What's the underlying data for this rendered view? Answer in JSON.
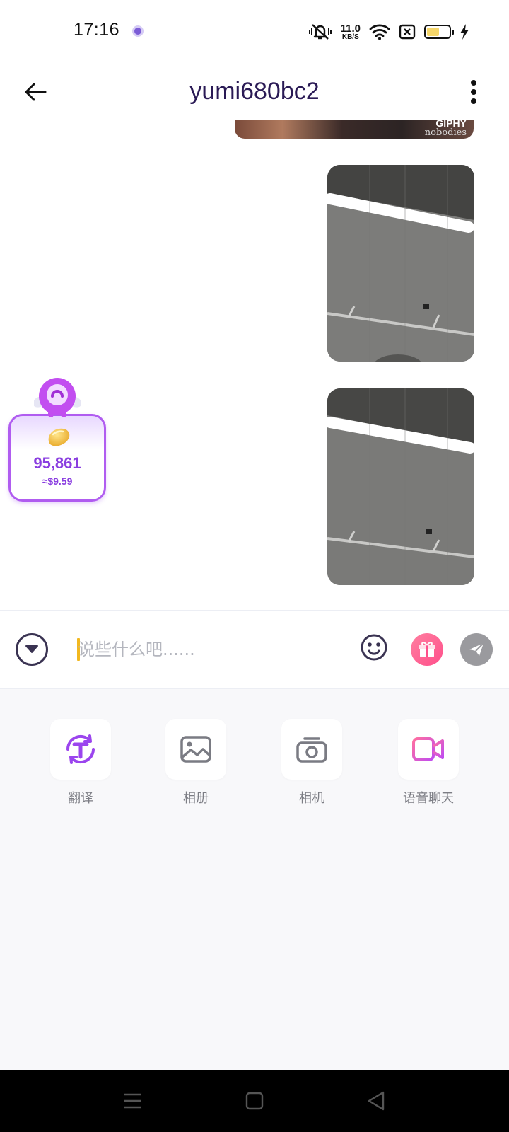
{
  "status_bar": {
    "time": "17:16",
    "net_speed_value": "11.0",
    "net_speed_unit": "KB/S",
    "battery_level": 0.6,
    "battery_color": "#f5d66a",
    "icons": [
      "app-notification-icon",
      "vibrate-icon",
      "wifi-icon",
      "no-sim-icon",
      "battery-icon",
      "charging-icon"
    ]
  },
  "header": {
    "title": "yumi680bc2",
    "back_icon": "back-arrow-icon",
    "more_icon": "more-vertical-icon"
  },
  "chat": {
    "gif_badge": "GIPHY",
    "gif_caption": "nobodies",
    "messages": [
      {
        "type": "gif",
        "side": "right"
      },
      {
        "type": "image",
        "side": "right"
      },
      {
        "type": "image",
        "side": "right"
      }
    ]
  },
  "reward": {
    "amount": "95,861",
    "usd": "≈$9.59",
    "icon": "bean-icon",
    "accent": "#a855f7"
  },
  "input": {
    "placeholder": "说些什么吧......",
    "value": "",
    "icons": [
      "collapse-icon",
      "emoji-icon",
      "gift-icon",
      "send-icon"
    ]
  },
  "tools": [
    {
      "label": "翻译",
      "icon": "translate-icon"
    },
    {
      "label": "相册",
      "icon": "album-icon"
    },
    {
      "label": "相机",
      "icon": "camera-icon"
    },
    {
      "label": "语音聊天",
      "icon": "video-call-icon"
    }
  ],
  "colors": {
    "title": "#2a1a55",
    "accent_purple": "#8a3ee0",
    "gift_pink": "#ff4f8b",
    "send_gray": "#9a9a9e"
  }
}
